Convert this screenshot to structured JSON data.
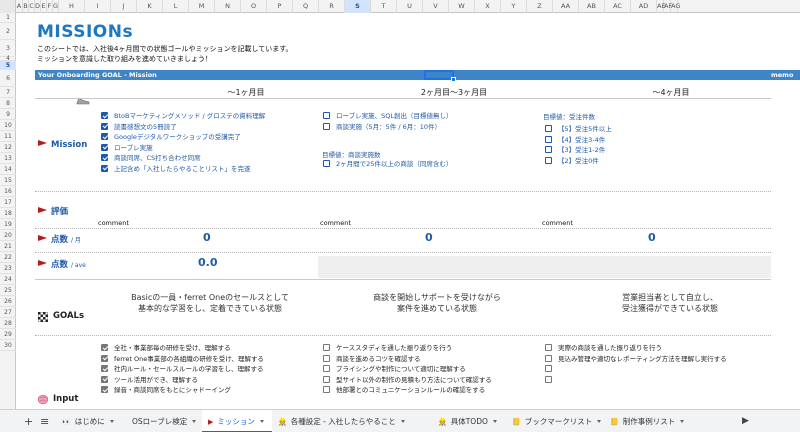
{
  "column_headers": [
    "A",
    "B",
    "C",
    "D",
    "E",
    "F",
    "G",
    "H",
    "I",
    "J",
    "K",
    "L",
    "M",
    "N",
    "O",
    "P",
    "Q",
    "R",
    "S",
    "T",
    "U",
    "V",
    "W",
    "X",
    "Y",
    "Z",
    "AA",
    "AB",
    "AC",
    "AD",
    "AE",
    "AF",
    "AG"
  ],
  "selected_column": "S",
  "row_headers": [
    "1",
    "2",
    "3",
    "4",
    "5",
    "6",
    "7",
    "8",
    "9",
    "10",
    "11",
    "12",
    "13",
    "14",
    "15",
    "16",
    "17",
    "18",
    "19",
    "20",
    "21",
    "22",
    "23",
    "24",
    "25",
    "26",
    "27",
    "28",
    "29",
    "30"
  ],
  "selected_row": "5",
  "sheet": {
    "title": "MISSIONs",
    "intro_lines": [
      "このシートでは、入社後4ヶ月間での状態ゴールやミッションを記載しています。",
      "ミッションを意識した取り組みを進めていきましょう！"
    ],
    "section_bar": "Your Onboarding GOAL - Mission",
    "memo": "memo",
    "periods": [
      "〜1ヶ月目",
      "2ヶ月目〜3ヶ月目",
      "〜4ヶ月目"
    ],
    "mission": {
      "label": "Mission",
      "col1": [
        {
          "text": "BtoBマーケティングメソッド / グロステの資料理解",
          "checked": true
        },
        {
          "text": "読書感想文の5冊読了",
          "checked": true
        },
        {
          "text": "Googleデジタルワークショップの受講完了",
          "checked": true
        },
        {
          "text": "ローブレ実施",
          "checked": true
        },
        {
          "text": "商談同席、CS打ち合わせ同席",
          "checked": true
        },
        {
          "text": "上記含め「入社したらやることリスト」を完遂",
          "checked": true
        }
      ],
      "col2": [
        {
          "text": "ローブレ実施、SQL創出（目標値無し）",
          "checked": false
        },
        {
          "text": "商談実施（5月：5件 / 6月：10件）",
          "checked": false
        }
      ],
      "col2_target_label": "目標値：商談実施数",
      "col2_extra": [
        {
          "text": "2ヶ月間で25件以上の商談（同席含む）",
          "checked": false
        }
      ],
      "col3_target_label": "目標値：受注件数",
      "col3": [
        {
          "text": "【5】受注5件以上",
          "checked": false
        },
        {
          "text": "【4】受注3-4件",
          "checked": false
        },
        {
          "text": "【3】受注1-2件",
          "checked": false
        },
        {
          "text": "【2】受注0件",
          "checked": false
        }
      ]
    },
    "evaluation": {
      "label": "評価",
      "comments": [
        "comment",
        "comment",
        "comment"
      ]
    },
    "points_month": {
      "label": "点数",
      "unit": "/ 月",
      "values": [
        "0",
        "0",
        "0"
      ]
    },
    "points_ave": {
      "label": "点数",
      "unit": "/ ave",
      "value": "0.0"
    },
    "goals": {
      "label": "GOALs",
      "items": [
        [
          "Basicの一員・ferret Oneのセールスとして",
          "基本的な学習をし、定着できている状態"
        ],
        [
          "商談を開始しサポートを受けながら",
          "案件を進めている状態"
        ],
        [
          "営業担当者として自立し、",
          "受注獲得ができている状態"
        ]
      ]
    },
    "input": {
      "label": "Input",
      "col1": [
        {
          "text": "全社・事業部毎の研修を受け、理解する",
          "checked": true
        },
        {
          "text": "ferret One事業部の各組織の研修を受け、理解する",
          "checked": true
        },
        {
          "text": "社内ルール・セールスルールの学習をし、理解する",
          "checked": true
        },
        {
          "text": "ツール活用ができ、理解する",
          "checked": true
        },
        {
          "text": "録音・商談同席をもとにシャドーイング",
          "checked": true
        }
      ],
      "col2": [
        {
          "text": "ケーススタディを通した振り返りを行う",
          "checked": false
        },
        {
          "text": "商談を進めるコツを確認する",
          "checked": false
        },
        {
          "text": "プライシングや制作について適切に理解する",
          "checked": false
        },
        {
          "text": "型サイト以外の制作の見積もり方法について確認する",
          "checked": false
        },
        {
          "text": "他部署とのコミュニケーションルールの確認をする",
          "checked": false
        }
      ],
      "col3": [
        {
          "text": "実際の商談を通した振り返りを行う",
          "checked": false
        },
        {
          "text": "見込み管理や適切なレポーティング方法を理解し実行する",
          "checked": false
        },
        {
          "text": "",
          "checked": false
        },
        {
          "text": "",
          "checked": false
        }
      ]
    }
  },
  "tabbar": {
    "add": "+",
    "menu": "≡",
    "tabs": [
      {
        "label": "はじめに",
        "icon": "eyes-icon",
        "glyph": "👀"
      },
      {
        "label": "OSローブレ検定",
        "icon": "",
        "glyph": ""
      },
      {
        "label": "ミッション",
        "icon": "flag-icon",
        "glyph": "▶"
      },
      {
        "label": "各種設定 - 入社したらやること",
        "icon": "person-icon",
        "glyph": "👷"
      },
      {
        "label": "具体TODO",
        "icon": "person-icon",
        "glyph": "👷"
      },
      {
        "label": "ブックマークリスト",
        "icon": "book-icon",
        "glyph": "📒"
      },
      {
        "label": "制作事例リスト",
        "icon": "book-icon",
        "glyph": "📒"
      }
    ],
    "active_tab": 2
  }
}
